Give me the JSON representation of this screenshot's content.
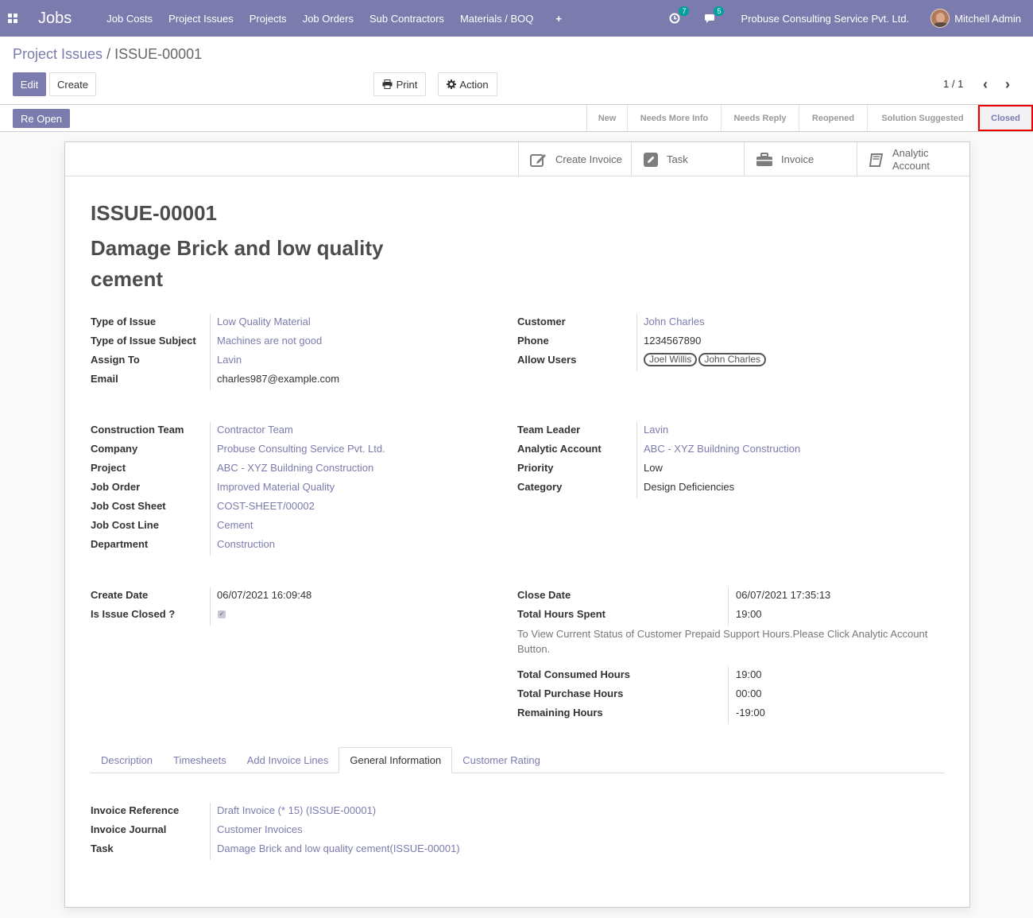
{
  "navbar": {
    "brand": "Jobs",
    "menu": [
      "Job Costs",
      "Project Issues",
      "Projects",
      "Job Orders",
      "Sub Contractors",
      "Materials / BOQ"
    ],
    "plus": "+",
    "activity_count": "7",
    "message_count": "5",
    "company": "Probuse Consulting Service Pvt. Ltd.",
    "user": "Mitchell Admin"
  },
  "breadcrumb": {
    "parent": "Project Issues",
    "separator": "/",
    "current": "ISSUE-00001"
  },
  "controls": {
    "edit": "Edit",
    "create": "Create",
    "print": "Print",
    "action": "Action",
    "pager": "1 / 1"
  },
  "statusbar": {
    "reopen": "Re Open",
    "stages": [
      "New",
      "Needs More Info",
      "Needs Reply",
      "Reopened",
      "Solution Suggested",
      "Closed"
    ],
    "active_stage": "Closed"
  },
  "smart_buttons": {
    "create_invoice": "Create Invoice",
    "task": "Task",
    "invoice": "Invoice",
    "analytic_line1": "Analytic",
    "analytic_line2": "Account"
  },
  "record": {
    "reference": "ISSUE-00001",
    "title": "Damage Brick and low quality cement"
  },
  "group1_left": [
    {
      "label": "Type of Issue",
      "value": "Low Quality Material"
    },
    {
      "label": "Type of Issue Subject",
      "value": "Machines are not good"
    },
    {
      "label": "Assign To",
      "value": "Lavin"
    },
    {
      "label": "Email",
      "value": "charles987@example.com"
    }
  ],
  "group1_right": {
    "customer_label": "Customer",
    "customer": "John Charles",
    "phone_label": "Phone",
    "phone": "1234567890",
    "allow_users_label": "Allow Users",
    "allow_users": [
      "Joel Willis",
      "John Charles"
    ]
  },
  "group2_left": [
    {
      "label": "Construction Team",
      "value": "Contractor Team"
    },
    {
      "label": "Company",
      "value": "Probuse Consulting Service Pvt. Ltd."
    },
    {
      "label": "Project",
      "value": "ABC - XYZ Buildning Construction"
    },
    {
      "label": "Job Order",
      "value": "Improved Material Quality"
    },
    {
      "label": "Job Cost Sheet",
      "value": "COST-SHEET/00002"
    },
    {
      "label": "Job Cost Line",
      "value": "Cement"
    },
    {
      "label": "Department",
      "value": "Construction"
    }
  ],
  "group2_right": [
    {
      "label": "Team Leader",
      "value": "Lavin"
    },
    {
      "label": "Analytic Account",
      "value": "ABC - XYZ Buildning Construction"
    },
    {
      "label": "Priority",
      "value": "Low"
    },
    {
      "label": "Category",
      "value": "Design Deficiencies"
    }
  ],
  "group3_left": {
    "create_date_label": "Create Date",
    "create_date": "06/07/2021 16:09:48",
    "is_closed_label": "Is Issue Closed ?",
    "is_closed": true
  },
  "group3_right": {
    "close_date_label": "Close Date",
    "close_date": "06/07/2021 17:35:13",
    "hours_spent_label": "Total Hours Spent",
    "hours_spent": "19:00",
    "note": "To View Current Status of Customer Prepaid Support Hours.Please Click Analytic Account Button.",
    "consumed_label": "Total Consumed Hours",
    "consumed": "19:00",
    "purchase_label": "Total Purchase Hours",
    "purchase": "00:00",
    "remaining_label": "Remaining Hours",
    "remaining": "-19:00"
  },
  "tabs": [
    "Description",
    "Timesheets",
    "Add Invoice Lines",
    "General Information",
    "Customer Rating"
  ],
  "active_tab": "General Information",
  "general_info": [
    {
      "label": "Invoice Reference",
      "value": "Draft Invoice (* 15) (ISSUE-00001)"
    },
    {
      "label": "Invoice Journal",
      "value": "Customer Invoices"
    },
    {
      "label": "Task",
      "value": "Damage Brick and low quality cement(ISSUE-00001)"
    }
  ],
  "colors": {
    "primary": "#7c7bad",
    "badge": "#00a09d",
    "highlight_border": "#ee0000"
  }
}
